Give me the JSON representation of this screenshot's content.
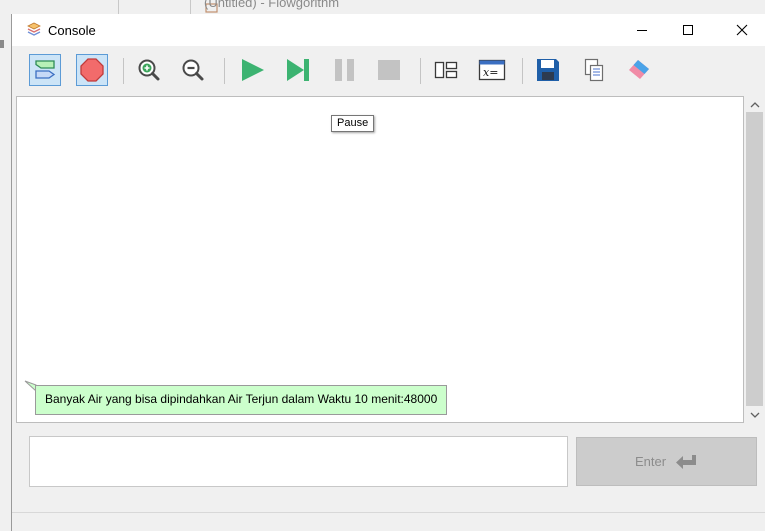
{
  "background_window": {
    "title": "(Untitled) - Flowgorithm"
  },
  "window": {
    "title": "Console",
    "minimize_label": "Minimize",
    "maximize_label": "Maximize",
    "close_label": "Close"
  },
  "toolbar": {
    "buttons": [
      {
        "name": "flowchart-mode",
        "icon": "flowchart-shape-icon",
        "active": true
      },
      {
        "name": "stop-sign-mode",
        "icon": "octagon-icon",
        "active": true
      },
      {
        "name": "zoom-in",
        "icon": "zoom-in-icon"
      },
      {
        "name": "zoom-out",
        "icon": "zoom-out-icon"
      },
      {
        "name": "run",
        "icon": "play-icon"
      },
      {
        "name": "step",
        "icon": "step-icon"
      },
      {
        "name": "pause",
        "icon": "pause-icon"
      },
      {
        "name": "stop",
        "icon": "stop-icon"
      },
      {
        "name": "layout",
        "icon": "layout-icon"
      },
      {
        "name": "variable-watch",
        "icon": "variable-icon"
      },
      {
        "name": "save",
        "icon": "save-icon"
      },
      {
        "name": "copy",
        "icon": "copy-icon"
      },
      {
        "name": "clear",
        "icon": "eraser-icon"
      }
    ]
  },
  "tooltip": {
    "text": "Pause"
  },
  "console": {
    "output_lines": [
      "Banyak Air yang bisa dipindahkan Air Terjun dalam Waktu 10 menit:48000"
    ]
  },
  "input": {
    "value": "",
    "placeholder": ""
  },
  "enter_button": {
    "label": "Enter"
  },
  "colors": {
    "accent_active": "#cce4f7",
    "run_green": "#3cb371",
    "output_bubble": "#ccffcc"
  }
}
